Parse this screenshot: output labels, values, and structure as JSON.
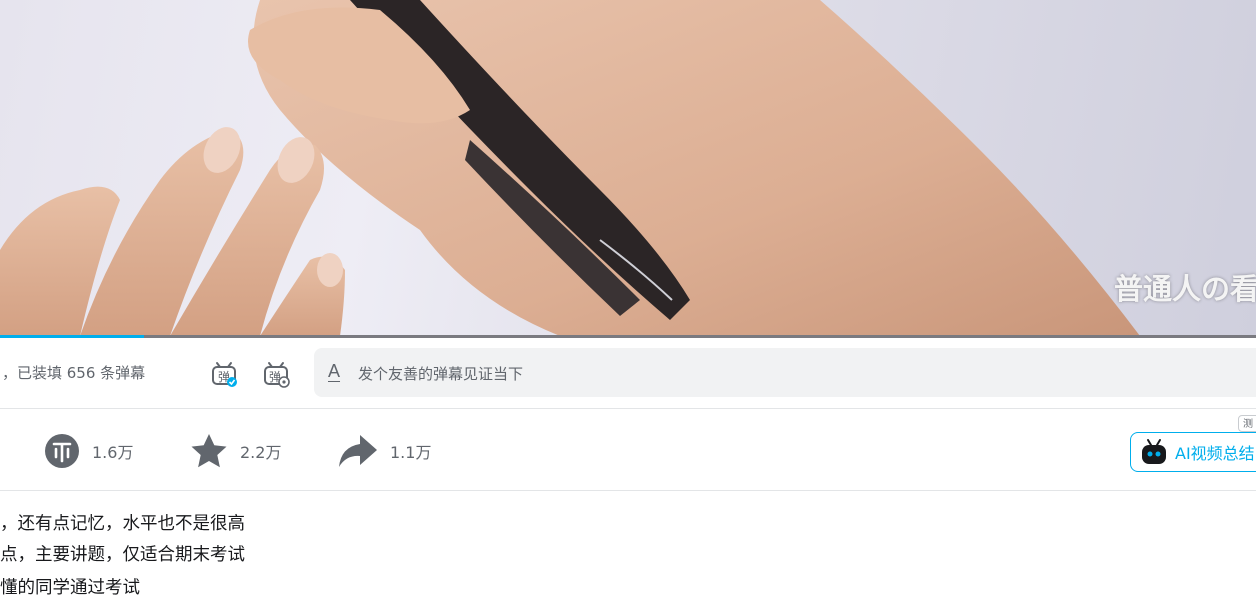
{
  "video": {
    "subtitle": "普通人の看",
    "progress_fraction": 0.115
  },
  "danmaku": {
    "info": "，已装填 656 条弹幕",
    "toggle_icon_glyph": "弹",
    "settings_icon_glyph": "弹",
    "input_icon": "A",
    "input_placeholder": "发个友善的弹幕见证当下"
  },
  "toolbar": {
    "coin_count": "1.6万",
    "favorite_count": "2.2万",
    "share_count": "1.1万",
    "ai_tag": "测",
    "ai_label": "AI视频总结"
  },
  "description": {
    "lines": [
      "，还有点记忆，水平也不是很高",
      "点，主要讲题，仅适合期末考试",
      "懂的同学通过考试"
    ]
  },
  "colors": {
    "accent": "#00aeec",
    "icon": "#61666d",
    "text": "#18191c"
  }
}
